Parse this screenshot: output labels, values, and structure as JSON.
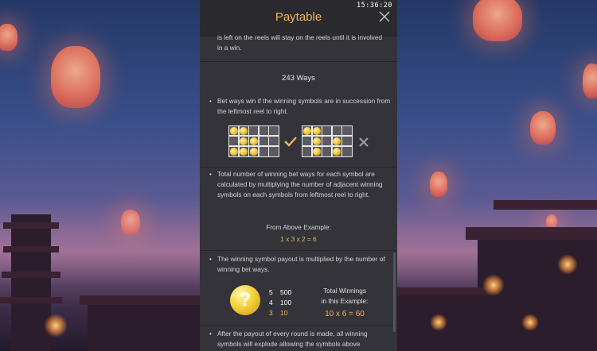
{
  "header": {
    "title": "Paytable",
    "clock": "15:36:20"
  },
  "icons": {
    "close": "close-icon",
    "check": "checkmark-icon",
    "cross": "x-mark-icon",
    "symbol": "question-mark-coin-icon"
  },
  "colors": {
    "title": "#f3b35a",
    "highlight": "#f3b35a",
    "panel": "#333339"
  },
  "intro": {
    "text": "is left on the reels will stay on the reels until it is involved in a win."
  },
  "ways": {
    "heading": "243 Ways",
    "bullet1": "Bet ways win if the winning symbols are in succession from the leftmost reel to right.",
    "bullet2": "Total number of winning bet ways for each symbol are calculated by multiplying the number of adjacent winning symbols on each symbols from leftmost reel to right.",
    "example_label": "From Above Example:",
    "example_formula": "1 x 3 x 2 = 6",
    "bullet3": "The winning symbol payout is multiplied by the number of winning bet ways.",
    "bullet4": "After the payout of every round is made, all winning symbols will explode allowing the symbols above"
  },
  "payouts": [
    {
      "count": "5",
      "amount": "500"
    },
    {
      "count": "4",
      "amount": "100"
    },
    {
      "count": "3",
      "amount": "10"
    }
  ],
  "total": {
    "label_line1": "Total Winnings",
    "label_line2": "in this Example:",
    "formula": "10 x 6 = 60"
  },
  "bullet_char": "•"
}
